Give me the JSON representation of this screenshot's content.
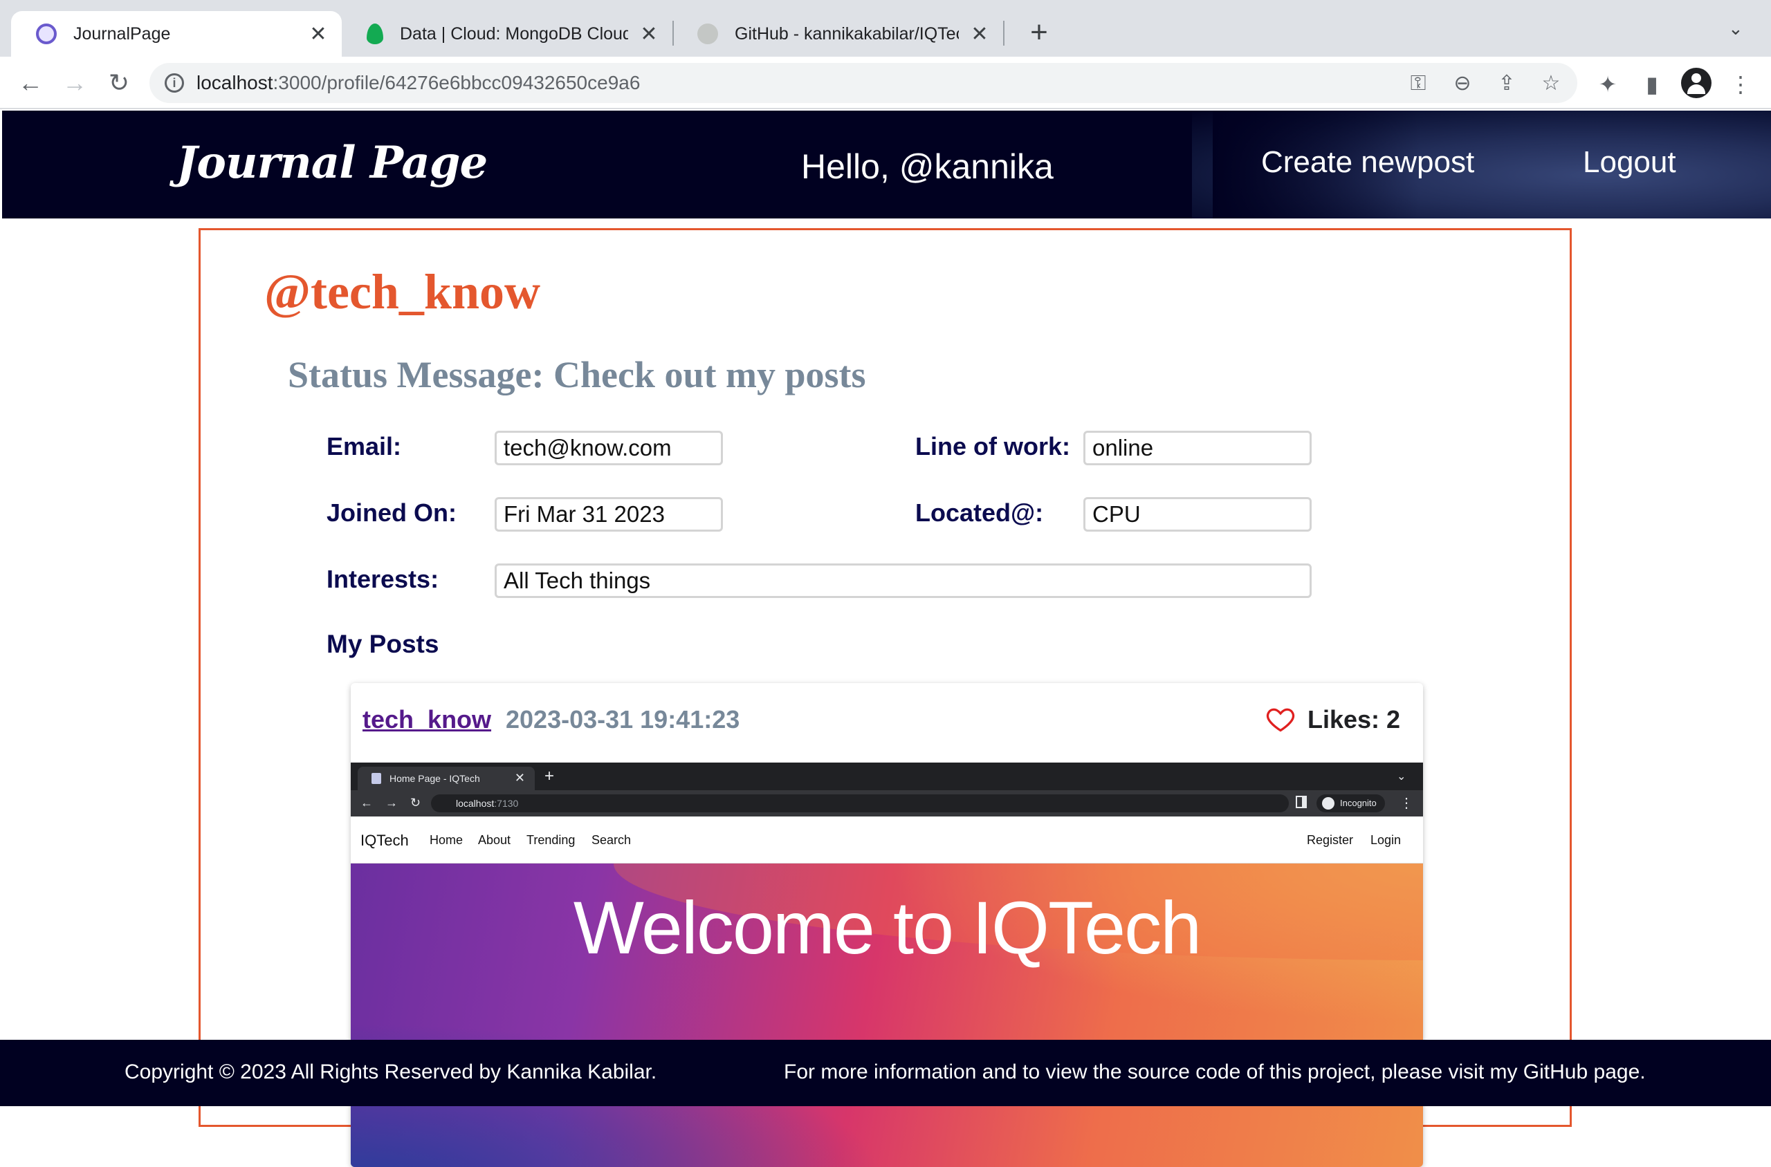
{
  "browser": {
    "tabs": [
      {
        "title": "JournalPage",
        "active": true,
        "favicon": "journal-favicon-icon",
        "color": "#6a5acd"
      },
      {
        "title": "Data | Cloud: MongoDB Cloud",
        "active": false,
        "favicon": "mongodb-leaf-icon",
        "color": "#13aa52"
      },
      {
        "title": "GitHub - kannikakabilar/IQTech",
        "active": false,
        "favicon": "github-icon",
        "color": "#c4c7c5"
      }
    ],
    "close_glyph": "✕",
    "new_tab_glyph": "+",
    "tab_menu_glyph": "⌄",
    "nav": {
      "back": "←",
      "forward": "→",
      "reload": "↻"
    },
    "url_host": "localhost",
    "url_path": ":3000/profile/64276e6bbcc09432650ce9a6",
    "info_glyph": "i",
    "icons": {
      "key": "⚿",
      "zoom": "⊖",
      "share": "⇪",
      "star": "☆",
      "extensions": "✦",
      "sidepanel": "▮",
      "menu": "⋮"
    }
  },
  "site": {
    "logo": "Journal Page",
    "greeting": "Hello, @kannika",
    "nav": {
      "create": "Create newpost",
      "logout": "Logout"
    },
    "colors": {
      "header_bg": "#010121",
      "accent": "#e4572e",
      "label": "#0b0b4f",
      "muted": "#778899"
    }
  },
  "profile": {
    "username": "@tech_know",
    "status": "Status Message: Check out my posts",
    "labels": {
      "email": "Email:",
      "line_of_work": "Line of work:",
      "joined": "Joined On:",
      "located": "Located@:",
      "interests": "Interests:"
    },
    "values": {
      "email": "tech@know.com",
      "line_of_work": "online",
      "joined": "Fri Mar 31 2023",
      "located": "CPU",
      "interests": "All Tech things"
    },
    "my_posts_heading": "My Posts"
  },
  "post": {
    "author": "tech_know",
    "date": "2023-03-31 19:41:23",
    "likes_label": "Likes: 2",
    "image": {
      "tab_title": "Home Page - IQTech",
      "tab_close": "✕",
      "tab_plus": "+",
      "tab_chevron": "⌄",
      "navs": "←→↻",
      "url_host": "localhost",
      "url_port": ":7130",
      "star": "☆",
      "incognito": "Incognito",
      "dots": "⋮",
      "brand": "IQTech",
      "links": [
        "Home",
        "About",
        "Trending",
        "Search"
      ],
      "right_links": [
        "Register",
        "Login"
      ],
      "hero_title": "Welcome to IQTech"
    }
  },
  "footer": {
    "copyright": "Copyright © 2023 All Rights Reserved by Kannika Kabilar.",
    "info": "For more information and to view the source code of this project, please visit my GitHub page."
  }
}
